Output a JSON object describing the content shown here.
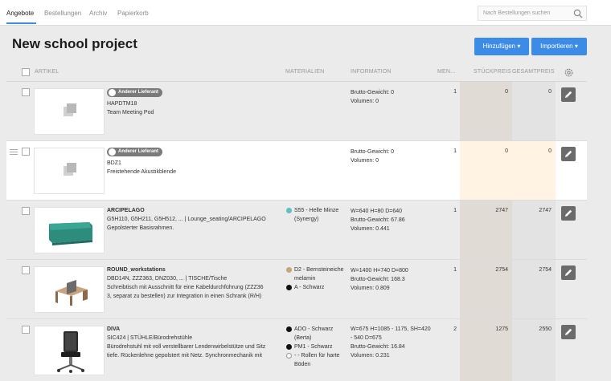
{
  "tabs": [
    {
      "label": "Angebote"
    },
    {
      "label": "Bestellungen"
    },
    {
      "label": "Archiv"
    },
    {
      "label": "Papierkorb"
    }
  ],
  "search": {
    "placeholder": "Nach Bestellungen suchen"
  },
  "page": {
    "title": "New school project"
  },
  "buttons": {
    "add": "Hinzufügen",
    "import": "Importieren"
  },
  "columns": {
    "article": "ARTIKEL",
    "materials": "MATERIALIEN",
    "information": "INFORMATION",
    "quantity": "MEN...",
    "unit_price": "STÜCKPREIS",
    "total_price": "GESAMTPREIS"
  },
  "colors": {
    "accent": "#3c8ce7",
    "highlight_row": "#fff4e4"
  },
  "rows": [
    {
      "supplier_tag": "Anderer Lieferant",
      "code": "HAPDTM18",
      "desc1": "Team Meeting Pod",
      "info1": "Brutto-Gewicht: 0",
      "info2": "Volumen: 0",
      "qty": "1",
      "unit_price": "0",
      "total_price": "0"
    },
    {
      "supplier_tag": "Anderer Lieferant",
      "code": "BDZ1",
      "desc1": "Freistehende Akustikblende",
      "info1": "Brutto-Gewicht: 0",
      "info2": "Volumen: 0",
      "qty": "1",
      "unit_price": "0",
      "total_price": "0"
    },
    {
      "name": "ARCIPELAGO",
      "code": "G5H110, G5H211, G5H512, ... | Lounge_seating/ARCIPELAGO",
      "desc1": "Gepolsterter Basisrahmen.",
      "materials": [
        {
          "line1": "S55 - Helle Minze",
          "line2": "(Synergy)",
          "color": "#5fc0bd"
        }
      ],
      "info0": "W=640 H=80 D=640",
      "info1": "Brutto-Gewicht: 67.86",
      "info2": "Volumen: 0.441",
      "qty": "1",
      "unit_price": "2747",
      "total_price": "2747"
    },
    {
      "name": "ROUND_workstations",
      "code": "DBD14N, ZZZ363, DNZ030, ... | TISCHE/Tische",
      "desc1": "Schreibtisch mit Ausschnitt für eine Kabeldurchführung (ZZZ36",
      "desc2": "3, separat zu bestellen) zur Integration in einen Schrank (R/H)",
      "materials": [
        {
          "line1": "D2 - Bernsteineiche",
          "line2": "melamin",
          "color": "#c8a47c"
        },
        {
          "line1": "A - Schwarz",
          "line2": "",
          "color": "#111111"
        }
      ],
      "info0": "W=1400 H=740 D=800",
      "info1": "Brutto-Gewicht: 168.3",
      "info2": "Volumen: 0.809",
      "qty": "1",
      "unit_price": "2754",
      "total_price": "2754"
    },
    {
      "name": "DIVA",
      "code": "SIC424 | STÜHLE/Bürodrehstühle",
      "desc1": "Bürodrehstuhl mit voll verstellbarer Lendenwirbelstütze und Sitz",
      "desc2": "tiefe. Rückenlehne gepolstert mit Netz. Synchronmechanik mit",
      "materials": [
        {
          "line1": "ADO - Schwarz",
          "line2": "(Berta)",
          "color": "#111111"
        },
        {
          "line1": "PM1 - Schwarz",
          "line2": "",
          "color": "#111111"
        },
        {
          "line1": "- - Rollen für harte",
          "line2": "Böden",
          "color": "#ffffff"
        }
      ],
      "info0": "W=675 H=1085 - 1175, SH=420",
      "info0b": "- 540 D=675",
      "info1": "Brutto-Gewicht: 16.84",
      "info2": "Volumen: 0.231",
      "qty": "2",
      "unit_price": "1275",
      "total_price": "2550"
    }
  ]
}
